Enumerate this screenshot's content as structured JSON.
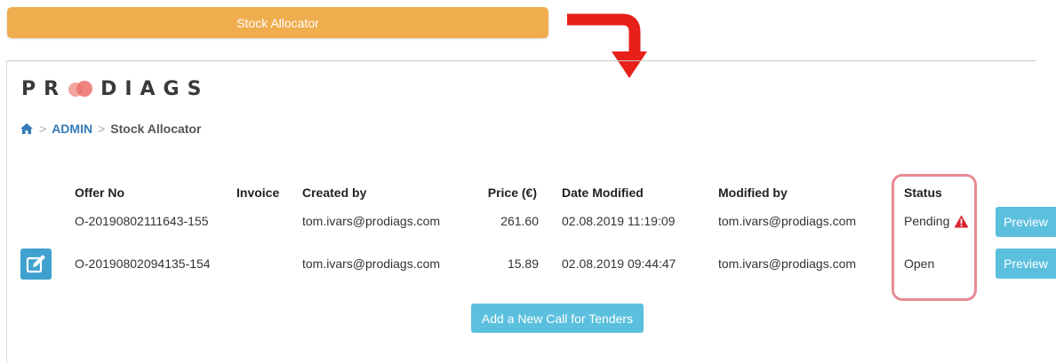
{
  "top_button": {
    "label": "Stock Allocator",
    "color": "#f0ad4e"
  },
  "logo": {
    "text_left": "PR",
    "text_right": "DIAGS"
  },
  "breadcrumb": {
    "home_icon": "home-icon",
    "separator": ">",
    "admin": "ADMIN",
    "current": "Stock Allocator"
  },
  "table": {
    "headers": [
      "Offer No",
      "Invoice",
      "Created by",
      "Price (€)",
      "Date Modified",
      "Modified by",
      "Status"
    ],
    "rows": [
      {
        "offer_no": "O-20190802111643-155",
        "invoice": "",
        "created_by": "tom.ivars@prodiags.com",
        "price": "261.60",
        "date_modified": "02.08.2019 11:19:09",
        "modified_by": "tom.ivars@prodiags.com",
        "status": "Pending",
        "status_icon": "warning-icon",
        "action": "Preview",
        "edit_icon": ""
      },
      {
        "offer_no": "O-20190802094135-154",
        "invoice": "",
        "created_by": "tom.ivars@prodiags.com",
        "price": "15.89",
        "date_modified": "02.08.2019 09:44:47",
        "modified_by": "tom.ivars@prodiags.com",
        "status": "Open",
        "status_icon": "",
        "action": "Preview",
        "edit_icon": "edit-icon"
      }
    ]
  },
  "add_button": {
    "label": "Add a New Call for Tenders"
  },
  "colors": {
    "accent_blue": "#5bc0de",
    "highlight_pink": "#e78b93",
    "arrow_red": "#e8201a"
  }
}
